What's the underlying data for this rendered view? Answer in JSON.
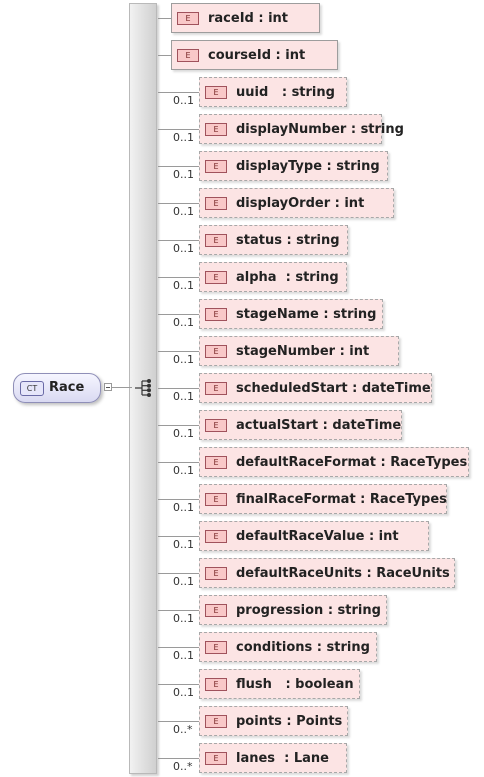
{
  "complex_type": {
    "badge": "CT",
    "name": "Race"
  },
  "element_badge": "E",
  "elements": [
    {
      "label": "raceId : int",
      "card": ""
    },
    {
      "label": "courseId : int",
      "card": ""
    },
    {
      "label": "uuid   : string",
      "card": "0..1"
    },
    {
      "label": "displayNumber : string",
      "card": "0..1"
    },
    {
      "label": "displayType : string",
      "card": "0..1"
    },
    {
      "label": "displayOrder : int",
      "card": "0..1"
    },
    {
      "label": "status : string",
      "card": "0..1"
    },
    {
      "label": "alpha  : string",
      "card": "0..1"
    },
    {
      "label": "stageName : string",
      "card": "0..1"
    },
    {
      "label": "stageNumber : int",
      "card": "0..1"
    },
    {
      "label": "scheduledStart : dateTime",
      "card": "0..1"
    },
    {
      "label": "actualStart : dateTime",
      "card": "0..1"
    },
    {
      "label": "defaultRaceFormat : RaceTypes",
      "card": "0..1"
    },
    {
      "label": "finalRaceFormat : RaceTypes",
      "card": "0..1"
    },
    {
      "label": "defaultRaceValue : int",
      "card": "0..1"
    },
    {
      "label": "defaultRaceUnits : RaceUnits",
      "card": "0..1"
    },
    {
      "label": "progression : string",
      "card": "0..1"
    },
    {
      "label": "conditions : string",
      "card": "0..1"
    },
    {
      "label": "flush   : boolean",
      "card": "0..1"
    },
    {
      "label": "points : Points",
      "card": "0..*"
    },
    {
      "label": "lanes  : Lane",
      "card": "0..*"
    }
  ]
}
